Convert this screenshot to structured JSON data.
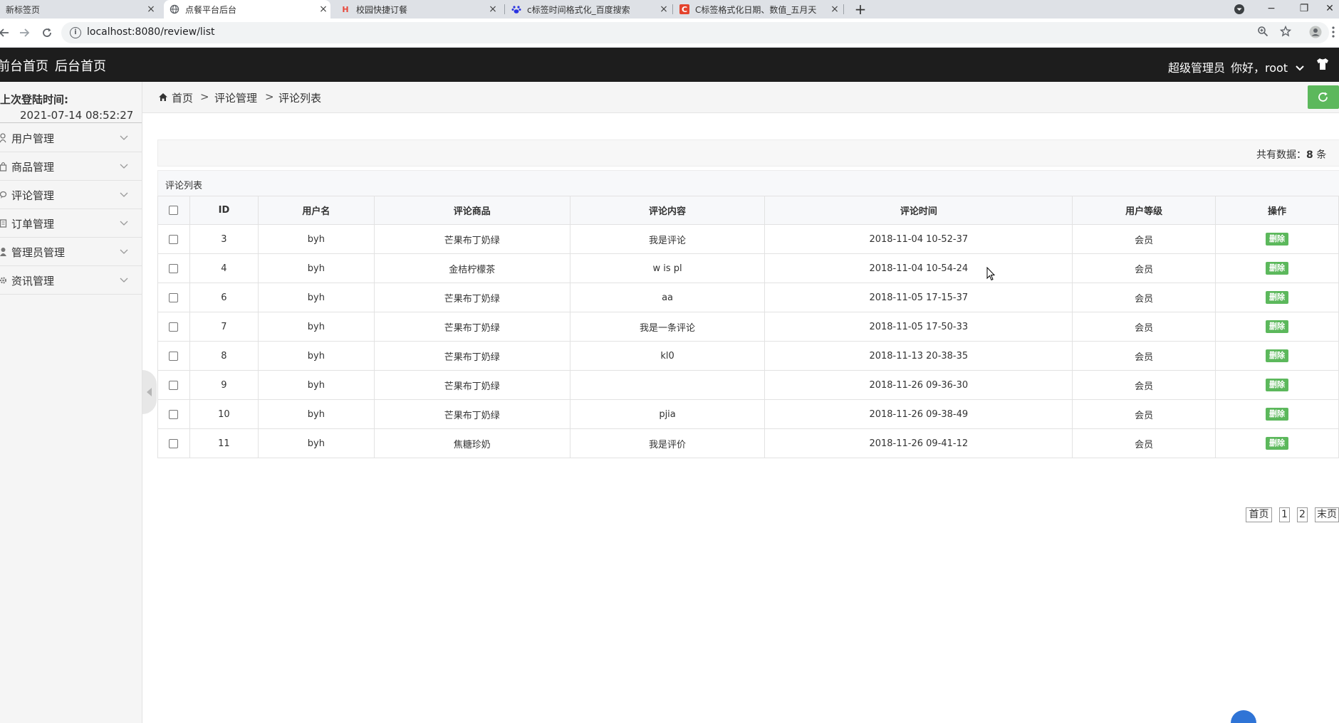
{
  "browser": {
    "tabs": [
      {
        "title": "新标签页",
        "active": false
      },
      {
        "title": "点餐平台后台",
        "active": true
      },
      {
        "title": "校园快捷订餐",
        "active": false
      },
      {
        "title": "c标签时间格式化_百度搜索",
        "active": false
      },
      {
        "title": "C标签格式化日期、数值_五月天",
        "active": false
      }
    ],
    "tab_close": "×",
    "new_tab": "+",
    "url": "localhost:8080/review/list",
    "window_controls": [
      "−",
      "❐",
      "✕"
    ]
  },
  "header": {
    "nav_front": "前台首页",
    "nav_back": "后台首页",
    "role": "超级管理员",
    "greeting": "你好，root"
  },
  "sidebar": {
    "login_label": "上次登陆时间:",
    "login_time": "2021-07-14 08:52:27",
    "items": [
      {
        "label": "用户管理",
        "icon": "user-icon"
      },
      {
        "label": "商品管理",
        "icon": "bag-icon"
      },
      {
        "label": "评论管理",
        "icon": "comment-icon"
      },
      {
        "label": "订单管理",
        "icon": "order-icon"
      },
      {
        "label": "管理员管理",
        "icon": "admin-icon"
      },
      {
        "label": "资讯管理",
        "icon": "gear-icon"
      }
    ]
  },
  "breadcrumb": {
    "home": "首页",
    "level1": "评论管理",
    "level2": "评论列表",
    "separator": ">"
  },
  "summary": {
    "prefix": "共有数据：",
    "count": "8",
    "suffix": " 条"
  },
  "panel": {
    "title": "评论列表"
  },
  "table": {
    "headers": [
      "ID",
      "用户名",
      "评论商品",
      "评论内容",
      "评论时间",
      "用户等级",
      "操作"
    ],
    "delete_label": "删除",
    "rows": [
      {
        "id": "3",
        "user": "byh",
        "product": "芒果布丁奶绿",
        "content": "我是评论",
        "time": "2018-11-04 10-52-37",
        "level": "会员"
      },
      {
        "id": "4",
        "user": "byh",
        "product": "金桔柠檬茶",
        "content": "w is pl",
        "time": "2018-11-04 10-54-24",
        "level": "会员"
      },
      {
        "id": "6",
        "user": "byh",
        "product": "芒果布丁奶绿",
        "content": "aa",
        "time": "2018-11-05 17-15-37",
        "level": "会员"
      },
      {
        "id": "7",
        "user": "byh",
        "product": "芒果布丁奶绿",
        "content": "我是一条评论",
        "time": "2018-11-05 17-50-33",
        "level": "会员"
      },
      {
        "id": "8",
        "user": "byh",
        "product": "芒果布丁奶绿",
        "content": "kl0",
        "time": "2018-11-13 20-38-35",
        "level": "会员"
      },
      {
        "id": "9",
        "user": "byh",
        "product": "芒果布丁奶绿",
        "content": "",
        "time": "2018-11-26 09-36-30",
        "level": "会员"
      },
      {
        "id": "10",
        "user": "byh",
        "product": "芒果布丁奶绿",
        "content": "pjia",
        "time": "2018-11-26 09-38-49",
        "level": "会员"
      },
      {
        "id": "11",
        "user": "byh",
        "product": "焦糖珍奶",
        "content": "我是评价",
        "time": "2018-11-26 09-41-12",
        "level": "会员"
      }
    ]
  },
  "pager": {
    "first": "首页",
    "pages": [
      "1",
      "2"
    ],
    "last": "末页"
  },
  "colors": {
    "header_bg": "#1d1d1d",
    "accent_green": "#5cb85c",
    "sidebar_bg": "#f5f5f5"
  }
}
